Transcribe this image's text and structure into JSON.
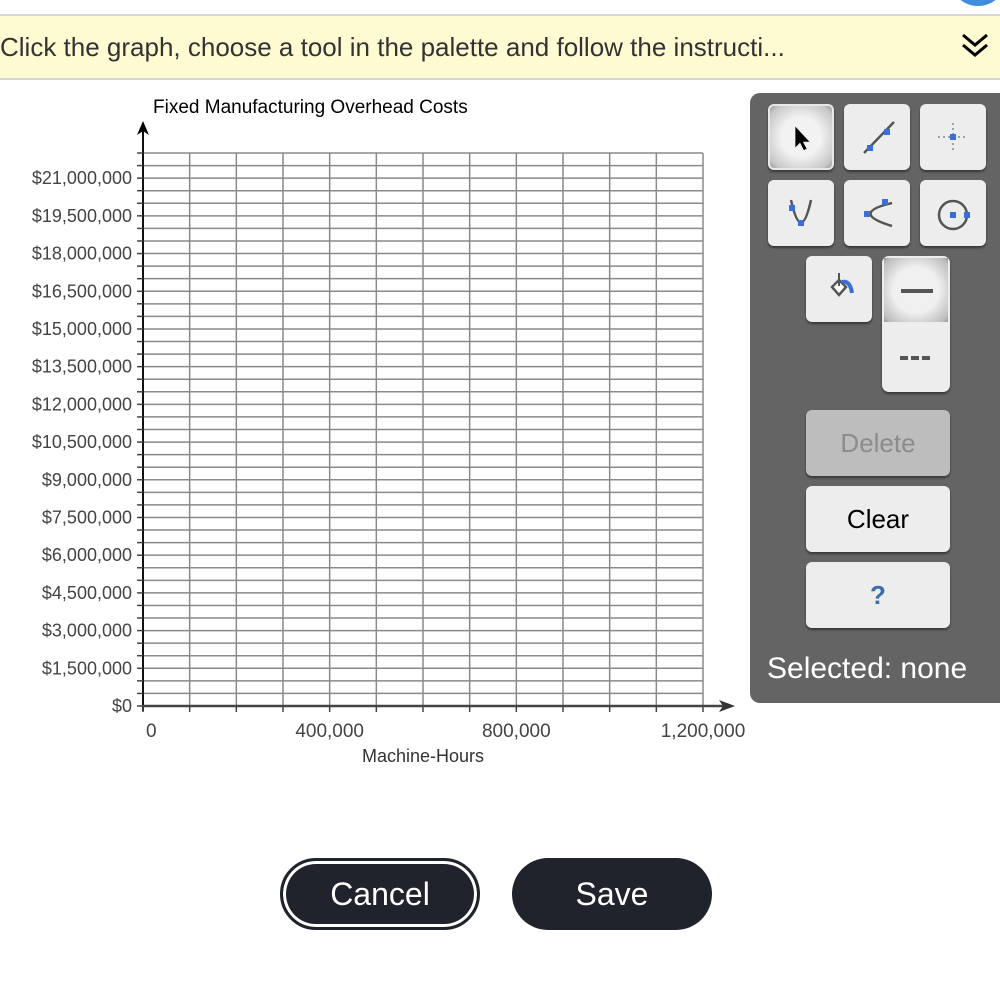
{
  "instructions": {
    "text": "Click the graph, choose a tool in the palette and follow the instructi...",
    "toggle_icon": "double-chevron-down-icon"
  },
  "chart_data": {
    "type": "line",
    "title": "Fixed Manufacturing Overhead Costs",
    "xlabel": "Machine-Hours",
    "ylabel": "",
    "xlim": [
      0,
      1200000
    ],
    "ylim": [
      0,
      22000000
    ],
    "x_major_step": 400000,
    "x_minor_step": 100000,
    "y_major_step": 1500000,
    "y_minor_step": 500000,
    "x_tick_labels": [
      "0",
      "400,000",
      "800,000",
      "1,200,000"
    ],
    "x_tick_values": [
      0,
      400000,
      800000,
      1200000
    ],
    "y_tick_labels": [
      "$0",
      "$1,500,000",
      "$3,000,000",
      "$4,500,000",
      "$6,000,000",
      "$7,500,000",
      "$9,000,000",
      "$10,500,000",
      "$12,000,000",
      "$13,500,000",
      "$15,000,000",
      "$16,500,000",
      "$18,000,000",
      "$19,500,000",
      "$21,000,000"
    ],
    "y_tick_values": [
      0,
      1500000,
      3000000,
      4500000,
      6000000,
      7500000,
      9000000,
      10500000,
      12000000,
      13500000,
      15000000,
      16500000,
      18000000,
      19500000,
      21000000
    ],
    "grid": true,
    "series": []
  },
  "palette": {
    "tools": [
      {
        "name": "pointer-tool",
        "icon": "arrow-pointer-icon",
        "selected": true
      },
      {
        "name": "line-tool",
        "icon": "line-segment-icon",
        "selected": false
      },
      {
        "name": "point-tool",
        "icon": "point-crosshair-icon",
        "selected": false
      },
      {
        "name": "parabola-tool",
        "icon": "parabola-icon",
        "selected": false
      },
      {
        "name": "horizontal-parabola-tool",
        "icon": "sideways-parabola-icon",
        "selected": false
      },
      {
        "name": "circle-tool",
        "icon": "circle-icon",
        "selected": false
      },
      {
        "name": "fill-tool",
        "icon": "paint-bucket-icon",
        "selected": false
      }
    ],
    "line_styles": [
      {
        "name": "solid",
        "icon": "solid-line-icon",
        "selected": true
      },
      {
        "name": "dashed",
        "icon": "dashed-line-icon",
        "selected": false
      }
    ],
    "delete_label": "Delete",
    "clear_label": "Clear",
    "help_label": "?",
    "selected_text": "Selected: none"
  },
  "buttons": {
    "cancel_label": "Cancel",
    "save_label": "Save"
  },
  "colors": {
    "accent_blue": "#3a6fd8",
    "palette_bg": "#646464",
    "button_dark": "#20232c",
    "instruction_bg": "#fefbd2"
  }
}
